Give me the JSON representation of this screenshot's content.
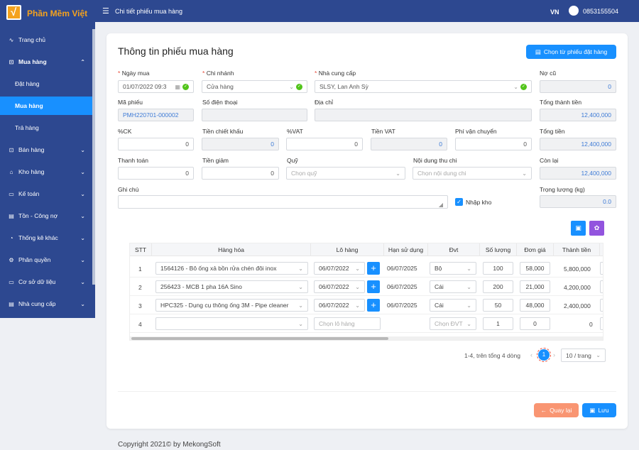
{
  "app": {
    "name": "Phần Mềm Việt",
    "logo_glyph": "√",
    "header_title": "Chi tiết phiếu mua hàng",
    "lang": "VN",
    "phone": "0853155504"
  },
  "sidebar": {
    "items": [
      {
        "label": "Trang chủ",
        "icon": "∿"
      },
      {
        "label": "Mua hàng",
        "icon": "⊡",
        "caret": "⌃"
      },
      {
        "label": "Đặt hàng"
      },
      {
        "label": "Mua hàng"
      },
      {
        "label": "Trả hàng"
      },
      {
        "label": "Bán hàng",
        "icon": "⊡",
        "caret": "⌄"
      },
      {
        "label": "Kho hàng",
        "icon": "⌂",
        "caret": "⌄"
      },
      {
        "label": "Kế toán",
        "icon": "▭",
        "caret": "⌄"
      },
      {
        "label": "Tồn - Công nợ",
        "icon": "▤",
        "caret": "⌄"
      },
      {
        "label": "Thống kê khác",
        "icon": "◔",
        "caret": "⌄"
      },
      {
        "label": "Phân quyền",
        "icon": "⚙",
        "caret": "⌄"
      },
      {
        "label": "Cơ sở dữ liệu",
        "icon": "▭",
        "caret": "⌄"
      },
      {
        "label": "Nhà cung cấp",
        "icon": "▤",
        "caret": "⌄"
      }
    ]
  },
  "form": {
    "title": "Thông tin phiếu mua hàng",
    "choose_order_btn": "Chọn từ phiếu đặt hàng",
    "req": "*",
    "ngay_mua": {
      "label": "Ngày mua",
      "value": "01/07/2022 09:3"
    },
    "chi_nhanh": {
      "label": "Chi nhánh",
      "value": "Cửa hàng"
    },
    "nha_cung_cap": {
      "label": "Nhà cung cấp",
      "value": "SLSY, Lan Anh Sỳ"
    },
    "no_cu": {
      "label": "Nợ cũ",
      "value": "0"
    },
    "ma_phieu": {
      "label": "Mã phiếu",
      "value": "PMH220701-000002"
    },
    "so_dien_thoai": {
      "label": "Số điện thoại",
      "value": ""
    },
    "dia_chi": {
      "label": "Địa chỉ",
      "value": ""
    },
    "tong_thanh_tien": {
      "label": "Tổng thành tiền",
      "value": "12,400,000"
    },
    "ck": {
      "label": "%CK",
      "value": "0"
    },
    "tien_chiet_khau": {
      "label": "Tiền chiết khấu",
      "value": "0"
    },
    "vat": {
      "label": "%VAT",
      "value": "0"
    },
    "tien_vat": {
      "label": "Tiền VAT",
      "value": "0"
    },
    "phi_van_chuyen": {
      "label": "Phí vận chuyển",
      "value": "0"
    },
    "tong_tien": {
      "label": "Tổng tiền",
      "value": "12,400,000"
    },
    "thanh_toan": {
      "label": "Thanh toán",
      "value": "0"
    },
    "tien_giam": {
      "label": "Tiền giảm",
      "value": "0"
    },
    "quy": {
      "label": "Quỹ",
      "placeholder": "Chọn quỹ"
    },
    "noi_dung_thu_chi": {
      "label": "Nội dung thu chi",
      "placeholder": "Chọn nội dung chi"
    },
    "con_lai": {
      "label": "Còn lại",
      "value": "12,400,000"
    },
    "ghi_chu": {
      "label": "Ghi chú",
      "value": ""
    },
    "nhap_kho": {
      "label": "Nhập kho",
      "checked": true
    },
    "trong_luong": {
      "label": "Trọng lượng (kg)",
      "value": "0.0"
    }
  },
  "table": {
    "headers": [
      "STT",
      "Hàng hóa",
      "Lô hàng",
      "Hạn sử dụng",
      "Đvt",
      "Số lượng",
      "Đơn giá",
      "Thành tiền"
    ],
    "rows": [
      {
        "stt": "1",
        "product": "1564126 - Bô ống xả bồn rửa chén đôi inox",
        "lot": "06/07/2022",
        "expiry": "06/07/2025",
        "unit": "Bộ",
        "qty": "100",
        "price": "58,000",
        "total": "5,800,000"
      },
      {
        "stt": "2",
        "product": "256423 - MCB 1 pha 16A Sino",
        "lot": "06/07/2022",
        "expiry": "06/07/2025",
        "unit": "Cái",
        "qty": "200",
        "price": "21,000",
        "total": "4,200,000"
      },
      {
        "stt": "3",
        "product": "HPC325 - Dụng cụ thông ống 3M - Pipe cleaner",
        "lot": "06/07/2022",
        "expiry": "06/07/2025",
        "unit": "Cái",
        "qty": "50",
        "price": "48,000",
        "total": "2,400,000"
      },
      {
        "stt": "4",
        "product": "",
        "lot_placeholder": "Chọn lô hàng",
        "expiry": "",
        "unit_placeholder": "Chọn ĐVT",
        "qty": "1",
        "price": "0",
        "total": "0"
      }
    ]
  },
  "pagination": {
    "summary": "1-4, trên tổng 4 dòng",
    "current": "1",
    "page_size": "10 / trang"
  },
  "actions": {
    "back": "Quay lại",
    "save": "Lưu"
  },
  "footer": {
    "text": "Copyright 2021© by MekongSoft"
  },
  "colors": {
    "primary": "#1890ff",
    "nav": "#2d4890",
    "brand": "#f4a21e",
    "back_button": "#f99572",
    "purple_tool": "#9254de"
  }
}
